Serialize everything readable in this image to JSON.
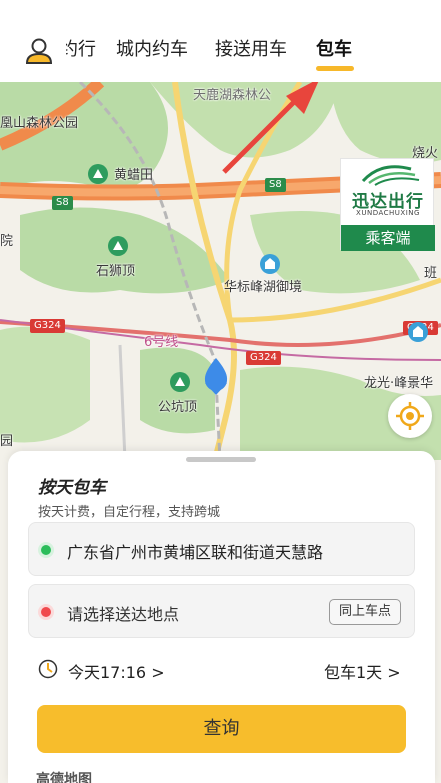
{
  "colors": {
    "accent": "#f7b82a",
    "brand_green": "#1f8a4c",
    "start_dot": "#2bbd5a",
    "end_dot": "#f0494d",
    "query_button": "#f7bd2c"
  },
  "tabs": [
    {
      "label": "约行",
      "active": false
    },
    {
      "label": "城内约车",
      "active": false
    },
    {
      "label": "接送用车",
      "active": false
    },
    {
      "label": "包车",
      "active": true
    }
  ],
  "map": {
    "labels": {
      "tianlu_lake": "天鹿湖森林公",
      "shan_forest": "凰山森林公园",
      "huangpi_tian": "黄蜡田",
      "shishi_ding": "石狮顶",
      "huabiao": "华标峰湖御境",
      "line6": "6号线",
      "gongkeng": "公坑顶",
      "longguang": "龙光·峰景华",
      "yuan": "院",
      "yuan2": "园",
      "shao": "烧火",
      "ban": "班"
    },
    "badges": {
      "s8": "S8",
      "g324": "G324"
    }
  },
  "brand": {
    "name": "迅达出行",
    "sub": "XUNDACHUXING",
    "role": "乘客端"
  },
  "sheet": {
    "title": "按天包车",
    "subtitle": "按天计费，自定行程，支持跨城",
    "start": "广东省广州市黄埔区联和街道天慧路",
    "destination_placeholder": "请选择送达地点",
    "same_pickup": "同上车点",
    "time": "今天17:16 >",
    "duration": "包车1天 >",
    "query": "查询",
    "map_logo": "高德地图"
  }
}
